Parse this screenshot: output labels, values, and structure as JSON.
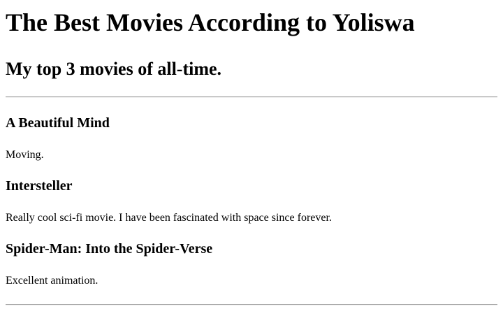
{
  "page": {
    "title": "The Best Movies According to Yoliswa",
    "subtitle": "My top 3 movies of all-time."
  },
  "movies": [
    {
      "title": "A Beautiful Mind",
      "description": "Moving."
    },
    {
      "title": "Intersteller",
      "description": "Really cool sci-fi movie. I have been fascinated with space since forever."
    },
    {
      "title": "Spider-Man: Into the Spider-Verse",
      "description": "Excellent animation."
    }
  ]
}
